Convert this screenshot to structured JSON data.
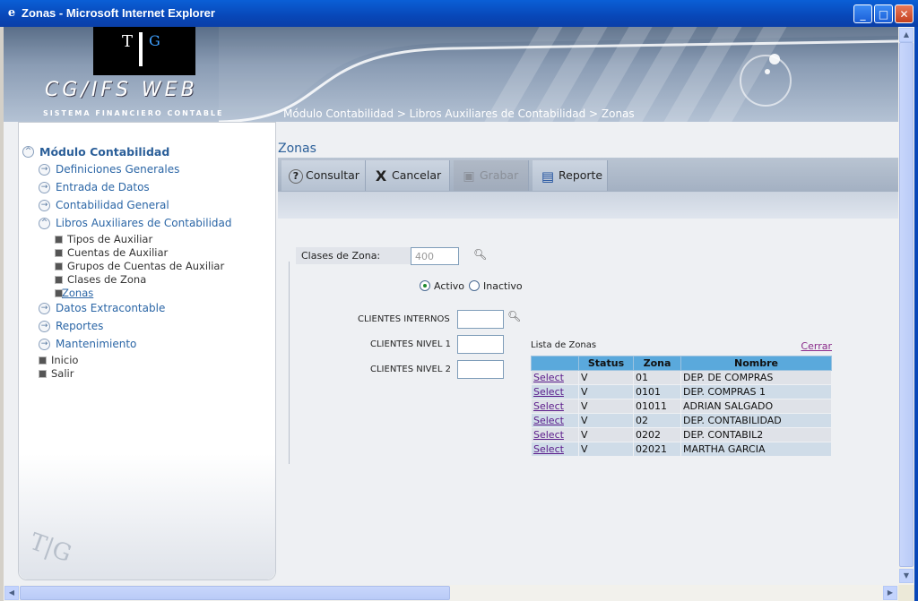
{
  "window": {
    "title": "Zonas - Microsoft Internet Explorer",
    "minimize": "_",
    "maximize": "□",
    "close": "✕"
  },
  "header": {
    "logo_t": "T",
    "logo_g": "G",
    "app_name": "CG/IFS  WEB",
    "app_subtitle": "SISTEMA FINANCIERO CONTABLE",
    "breadcrumb": "Módulo Contabilidad > Libros Auxiliares de Contabilidad > Zonas"
  },
  "sidebar": {
    "module": "Módulo Contabilidad",
    "items": [
      "Definiciones Generales",
      "Entrada de Datos",
      "Contabilidad General",
      "Libros Auxiliares de Contabilidad"
    ],
    "subitems": [
      "Tipos de Auxiliar",
      "Cuentas de Auxiliar",
      "Grupos de Cuentas de Auxiliar",
      "Clases de Zona",
      "Zonas"
    ],
    "more_items": [
      "Datos Extracontable",
      "Reportes",
      "Mantenimiento"
    ],
    "plain_items": [
      "Inicio",
      "Salir"
    ]
  },
  "page": {
    "title": "Zonas"
  },
  "toolbar": {
    "consultar": "Consultar",
    "cancelar": "Cancelar",
    "grabar": "Grabar",
    "reporte": "Reporte"
  },
  "form": {
    "clases_label": "Clases de Zona:",
    "clases_value": "400",
    "activo": "Activo",
    "inactivo": "Inactivo",
    "clientes_internos": "CLIENTES INTERNOS",
    "clientes_nivel1": "CLIENTES NIVEL 1",
    "clientes_nivel2": "CLIENTES NIVEL 2"
  },
  "lista": {
    "title": "Lista de Zonas",
    "close": "Cerrar",
    "headers": [
      "",
      "Status",
      "Zona",
      "Nombre"
    ],
    "rows": [
      {
        "select": "Select",
        "status": "V",
        "zona": "01",
        "nombre": "DEP. DE COMPRAS"
      },
      {
        "select": "Select",
        "status": "V",
        "zona": "0101",
        "nombre": "DEP. COMPRAS 1"
      },
      {
        "select": "Select",
        "status": "V",
        "zona": "01011",
        "nombre": "ADRIAN SALGADO"
      },
      {
        "select": "Select",
        "status": "V",
        "zona": "02",
        "nombre": "DEP. CONTABILIDAD"
      },
      {
        "select": "Select",
        "status": "V",
        "zona": "0202",
        "nombre": "DEP. CONTABIL2"
      },
      {
        "select": "Select",
        "status": "V",
        "zona": "02021",
        "nombre": "MARTHA GARCIA"
      }
    ]
  }
}
